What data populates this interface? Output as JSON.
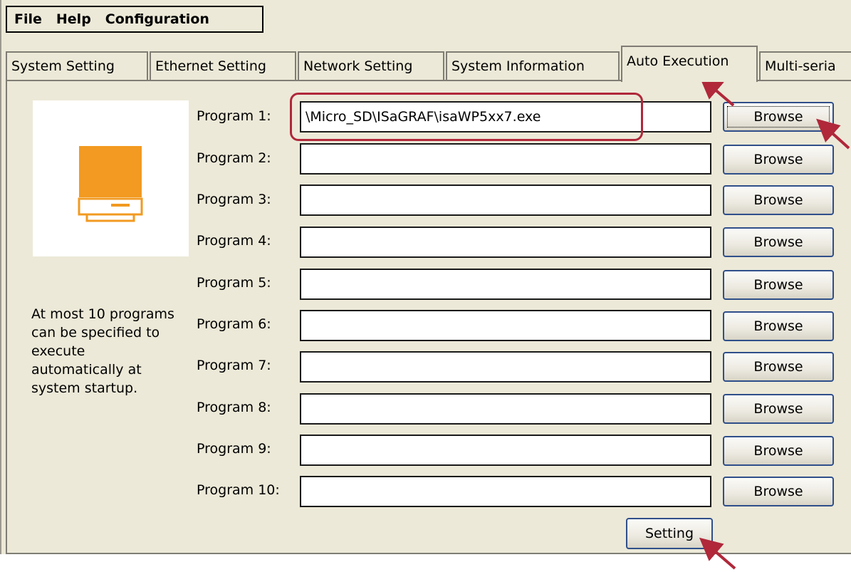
{
  "menu": {
    "items": [
      "File",
      "Help",
      "Configuration"
    ]
  },
  "tabs": [
    {
      "label": "System Setting",
      "active": false
    },
    {
      "label": "Ethernet Setting",
      "active": false
    },
    {
      "label": "Network Setting",
      "active": false
    },
    {
      "label": "System Information",
      "active": false
    },
    {
      "label": "Auto Execution",
      "active": true
    },
    {
      "label": "Multi-seria",
      "active": false
    }
  ],
  "icon": {
    "name": "computer-icon",
    "color": "#f29a21"
  },
  "description": "At most 10 programs can be specified to execute automatically at system startup.",
  "programs": [
    {
      "label": "Program 1:",
      "value": "\\Micro_SD\\ISaGRAF\\isaWP5xx7.exe",
      "button": "Browse"
    },
    {
      "label": "Program 2:",
      "value": "",
      "button": "Browse"
    },
    {
      "label": "Program 3:",
      "value": "",
      "button": "Browse"
    },
    {
      "label": "Program 4:",
      "value": "",
      "button": "Browse"
    },
    {
      "label": "Program 5:",
      "value": "",
      "button": "Browse"
    },
    {
      "label": "Program 6:",
      "value": "",
      "button": "Browse"
    },
    {
      "label": "Program 7:",
      "value": "",
      "button": "Browse"
    },
    {
      "label": "Program 8:",
      "value": "",
      "button": "Browse"
    },
    {
      "label": "Program 9:",
      "value": "",
      "button": "Browse"
    },
    {
      "label": "Program 10:",
      "value": "",
      "button": "Browse"
    }
  ],
  "setting_button": "Setting",
  "annotation_color": "#b0283a"
}
